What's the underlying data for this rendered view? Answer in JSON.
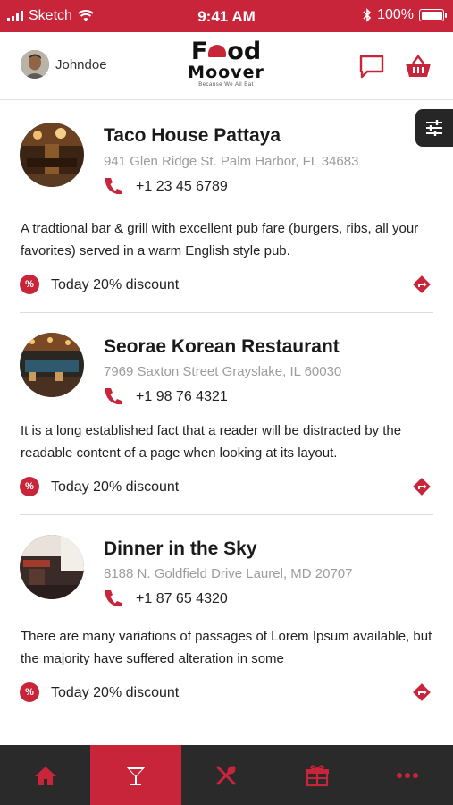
{
  "status_bar": {
    "carrier": "Sketch",
    "time": "9:41 AM",
    "battery": "100%"
  },
  "header": {
    "username": "Johndoe",
    "logo_line1_pre": "F",
    "logo_line1_post": "od",
    "logo_line2": "Moover",
    "logo_tagline": "Because We All Eat"
  },
  "restaurants": [
    {
      "name": "Taco House Pattaya",
      "address": "941 Glen Ridge St. Palm Harbor, FL 34683",
      "phone": "+1 23 45 6789",
      "description": "A tradtional bar & grill with excellent pub fare (burgers, ribs, all your favorites) served in a warm English style pub.",
      "discount": "Today 20% discount"
    },
    {
      "name": "Seorae Korean Restaurant",
      "address": "7969 Saxton Street Grayslake, IL 60030",
      "phone": "+1 98 76 4321",
      "description": "It is a long established fact that a reader will be distracted by the readable content of a page when looking at its layout.",
      "discount": "Today 20% discount"
    },
    {
      "name": "Dinner in the Sky",
      "address": "8188 N. Goldfield Drive Laurel, MD 20707",
      "phone": "+1 87 65 4320",
      "description": "There are many variations of passages of Lorem Ipsum available, but the majority have suffered alteration in some",
      "discount": "Today 20% discount"
    }
  ],
  "discount_badge_glyph": "%",
  "tabbar": {
    "items": [
      "home-icon",
      "cocktail-icon",
      "utensils-icon",
      "gift-icon",
      "more-icon"
    ],
    "active_index": 1
  },
  "colors": {
    "brand": "#c8253a",
    "tabbar_bg": "#2a2a2a",
    "secondary_text": "#9c9c9c"
  }
}
